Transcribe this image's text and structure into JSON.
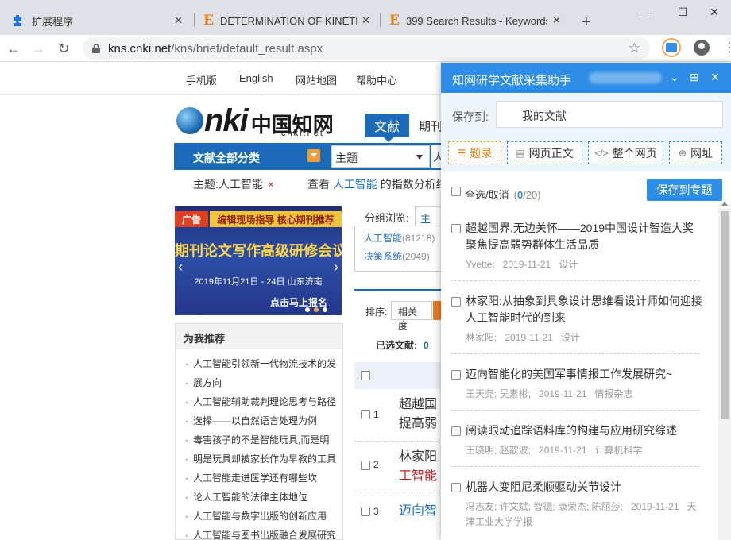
{
  "browser": {
    "tabs": [
      {
        "title": "扩展程序",
        "icon": "puzzle-icon"
      },
      {
        "title": "DETERMINATION OF KINETIC",
        "icon": "e-favicon"
      },
      {
        "title": "399 Search Results - Keywords",
        "icon": "e-favicon"
      }
    ],
    "url_host": "kns.cnki.net",
    "url_path": "/kns/brief/default_result.aspx"
  },
  "topnav": [
    "手机版",
    "English",
    "网站地图",
    "帮助中心"
  ],
  "logo": {
    "brand": "nki",
    "cn": "中国知网",
    "url": "cnki.net"
  },
  "search": {
    "tab_active": "文献",
    "tab_next": "期刊",
    "category": "文献全部分类",
    "field": "主题",
    "keyword": "人"
  },
  "filter": {
    "tag": "主题:人工智能",
    "view_prefix": "查看",
    "view_kw": "人工智能",
    "view_suffix": "的指数分析结果"
  },
  "banner": {
    "ad": "广告",
    "strip": "编辑现场指导  核心期刊推荐",
    "headline": "期刊论文写作高级研修会议",
    "date": "2019年11月21日 - 24日  山东济南",
    "cta": "点击马上报名"
  },
  "recommend": {
    "title": "为我推荐",
    "items": [
      "人工智能引领新一代物流技术的发",
      "展方向",
      "人工智能辅助裁判理论思考与路径",
      "选择——以自然语言处理为例",
      "毒害孩子的不是智能玩具,而是明",
      "明是玩具却被家长作为早教的工具",
      "人工智能走进医学还有哪些坎",
      "论人工智能的法律主体地位",
      "人工智能与数字出版的创新应用",
      "人工智能与图书出版融合发展研究"
    ]
  },
  "group": {
    "label": "分组浏览:",
    "tab": "主题",
    "items": [
      {
        "name": "人工智能",
        "count": "(81218)"
      },
      {
        "name": "决策系统",
        "count": "(2049)"
      }
    ]
  },
  "results": {
    "sort_label": "排序:",
    "sort_active": "相关度",
    "selected_label": "已选文献:",
    "selected_count": "0",
    "rows": [
      {
        "num": "1",
        "line1": "超越国",
        "line2": "提高弱"
      },
      {
        "num": "2",
        "line1": "林家阳",
        "line2": "工智能"
      },
      {
        "num": "3",
        "line1": "迈向智",
        "line2": ""
      }
    ]
  },
  "panel": {
    "title": "知网研学文献采集助手",
    "save_label": "保存到:",
    "save_value": "我的文献",
    "modes": [
      "题录",
      "网页正文",
      "整个网页",
      "网址"
    ],
    "select_all": "全选/取消",
    "count_selected": "0",
    "count_total": "/20",
    "save_btn": "保存到专题",
    "items": [
      {
        "title": "超越国界,无边关怀——2019中国设计智造大奖聚焦提高弱势群体生活品质",
        "authors": "Yvette;",
        "date": "2019-11-21",
        "source": "设计"
      },
      {
        "title": "林家阳:从抽象到具象设计思维看设计师如何迎接人工智能时代的到来",
        "authors": "林家阳;",
        "date": "2019-11-21",
        "source": "设计"
      },
      {
        "title": "迈向智能化的美国军事情报工作发展研究~",
        "authors": "王天尧; 吴素彬;",
        "date": "2019-11-21",
        "source": "情报杂志"
      },
      {
        "title": "阅读眼动追踪语料库的构建与应用研究综述",
        "authors": "王晓明; 赵歆波;",
        "date": "2019-11-21",
        "source": "计算机科学"
      },
      {
        "title": "机器人变阻尼柔顺驱动关节设计",
        "authors": "冯志友; 许文斌; 智德; 康荣杰; 陈丽莎;",
        "date": "2019-11-21",
        "source": "天津工业大学学报"
      }
    ]
  }
}
